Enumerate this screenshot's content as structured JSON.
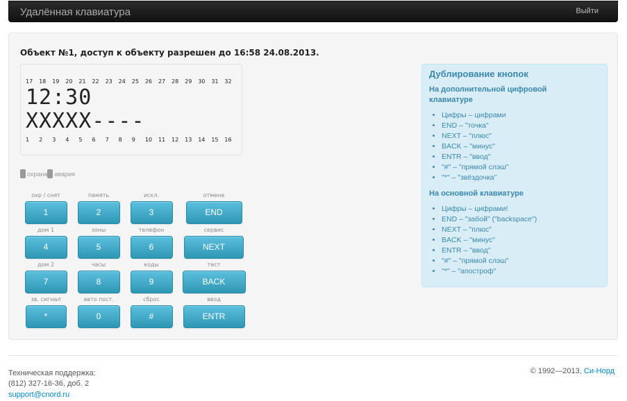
{
  "navbar": {
    "title": "Удалённая клавиатура",
    "logout": "Выйти"
  },
  "panel": {
    "object_title": "Объект №1, доступ к объекту разрешен до 16:58 24.08.2013."
  },
  "display": {
    "zones_top": [
      "17",
      "18",
      "19",
      "20",
      "21",
      "22",
      "23",
      "24",
      "25",
      "26",
      "27",
      "28",
      "29",
      "30",
      "31",
      "32"
    ],
    "line1": "12:30",
    "line2": "XXXXX----",
    "zones_bottom": [
      "1",
      "2",
      "3",
      "4",
      "5",
      "6",
      "7",
      "8",
      "9",
      "10",
      "11",
      "12",
      "13",
      "14",
      "15",
      "16"
    ]
  },
  "indicators": {
    "guard": "охрана",
    "alarm": "авария"
  },
  "keypad": {
    "rows": [
      [
        {
          "label": "охр / снят",
          "key": "1"
        },
        {
          "label": "память",
          "key": "2"
        },
        {
          "label": "искл.",
          "key": "3"
        },
        {
          "label": "отмена",
          "key": "END"
        }
      ],
      [
        {
          "label": "дом 1",
          "key": "4"
        },
        {
          "label": "зоны",
          "key": "5"
        },
        {
          "label": "телефон",
          "key": "6"
        },
        {
          "label": "сервис",
          "key": "NEXT"
        }
      ],
      [
        {
          "label": "дом 2",
          "key": "7"
        },
        {
          "label": "часы",
          "key": "8"
        },
        {
          "label": "коды",
          "key": "9"
        },
        {
          "label": "тест",
          "key": "BACK"
        }
      ],
      [
        {
          "label": "зв. сигнал",
          "key": "*"
        },
        {
          "label": "авто пост.",
          "key": "0"
        },
        {
          "label": "сброс",
          "key": "#"
        },
        {
          "label": "ввод",
          "key": "ENTR"
        }
      ]
    ]
  },
  "help": {
    "title": "Дублирование кнопок",
    "numpad_title": "На дополнительной цифровой клавиатуре",
    "numpad_items": [
      "Цифры – цифрами",
      "END – \"точка\"",
      "NEXT – \"плюс\"",
      "BACK – \"минус\"",
      "ENTR – \"ввод\"",
      "\"#\" – \"прямой слэш\"",
      "\"*\" – \"звёздочка\""
    ],
    "main_title": "На основной клавиатуре",
    "main_items": [
      "Цифры – цифрами!",
      "END – \"забой\" (\"backspace\")",
      "NEXT – \"плюс\"",
      "BACK – \"минус\"",
      "ENTR – \"ввод\"",
      "\"#\" – \"прямой слэш\"",
      "\"*\" – \"апостроф\""
    ]
  },
  "footer": {
    "support_label": "Техническая поддержка:",
    "phone": "(812) 327-16-36, доб. 2",
    "email": "support@cnord.ru",
    "copyright": "© 1992—2013, ",
    "company": "Си-Норд"
  },
  "colors": {
    "key_gradient_top": "#5bc0de",
    "key_gradient_bottom": "#2f96b4",
    "help_bg": "#d9edf7",
    "help_text": "#3a87ad",
    "link": "#0088cc"
  }
}
